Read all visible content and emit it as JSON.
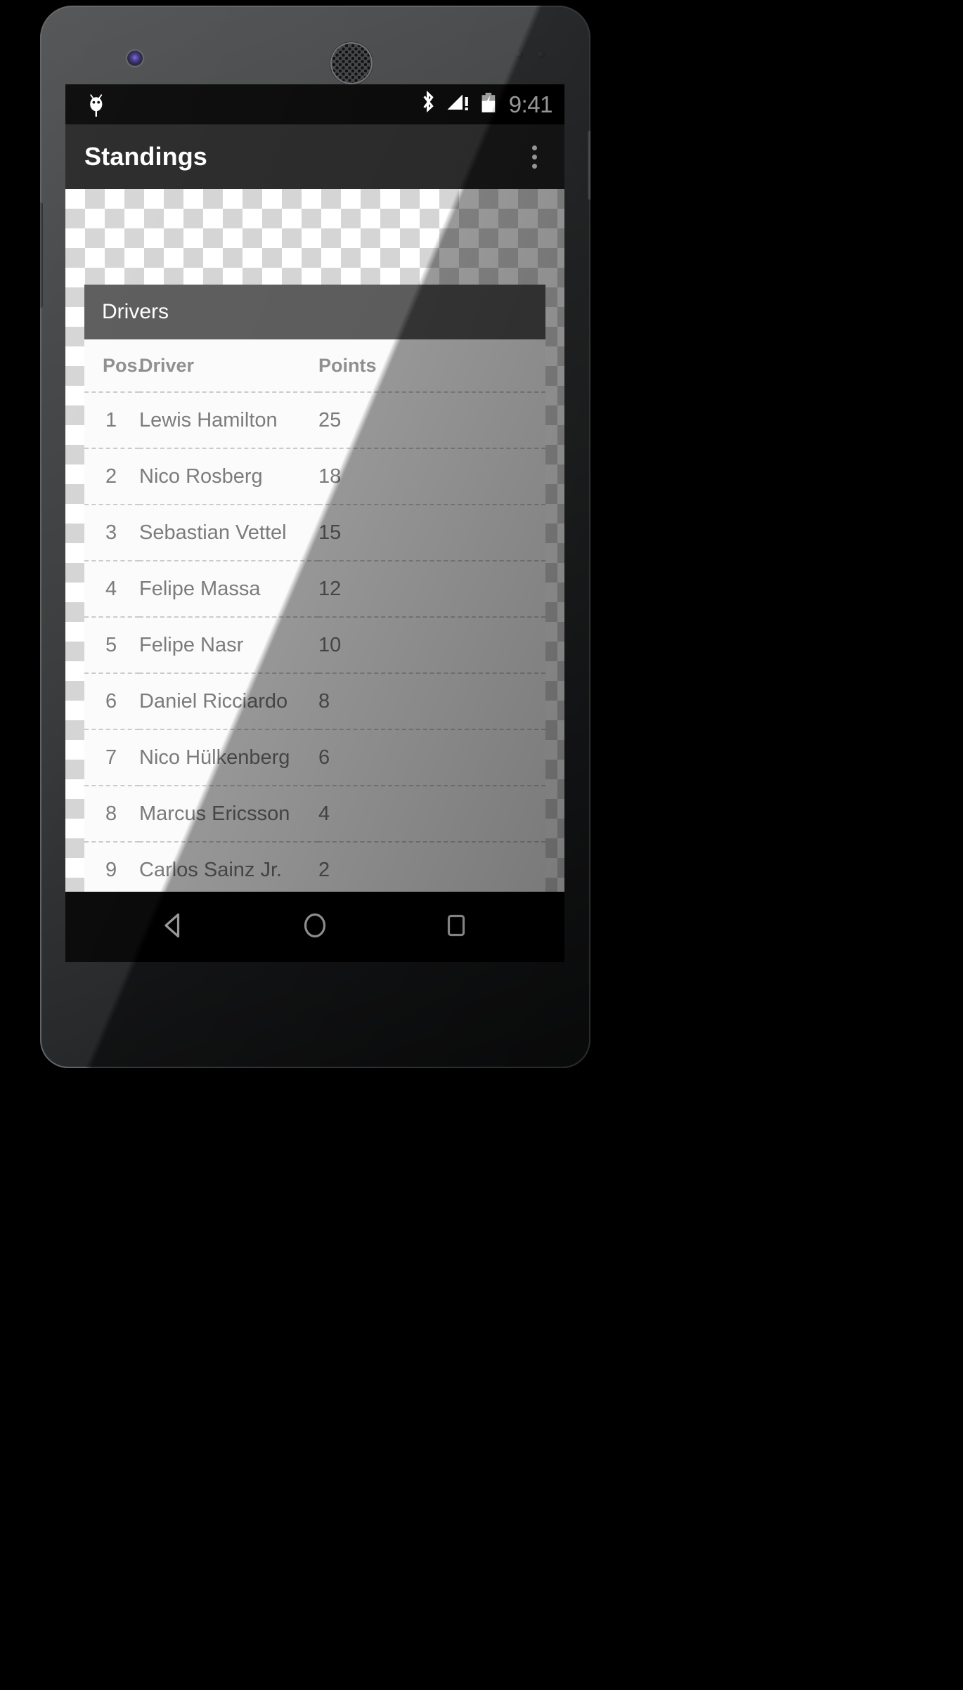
{
  "device": {
    "kind": "android-phone-mockup",
    "camera_icon": "front-camera-icon",
    "speaker_icon": "earpiece-speaker-icon"
  },
  "status_bar": {
    "left_icon": "android-bugdroid-icon",
    "icons": [
      "bluetooth-icon",
      "cellular-signal-no-service-icon",
      "battery-charging-icon"
    ],
    "clock": "9:41",
    "background_color": "#000000",
    "foreground_color": "#ffffff"
  },
  "app_bar": {
    "title": "Standings",
    "overflow_icon": "overflow-menu-icon",
    "background_color": "#212121",
    "title_color": "#ffffff"
  },
  "content": {
    "background": "transparency-checkerboard",
    "checker_light": "#ffffff",
    "checker_dark": "#d3d3d3"
  },
  "card": {
    "header_title": "Drivers",
    "header_background": "#555555",
    "header_text_color": "#ffffff",
    "body_background": "#fbfbfb",
    "divider_color": "#c8c8c8",
    "columns": [
      "Pos.",
      "Driver",
      "Points"
    ],
    "rows": [
      {
        "pos": "1",
        "driver": "Lewis Hamilton",
        "points": "25"
      },
      {
        "pos": "2",
        "driver": "Nico Rosberg",
        "points": "18"
      },
      {
        "pos": "3",
        "driver": "Sebastian Vettel",
        "points": "15"
      },
      {
        "pos": "4",
        "driver": "Felipe Massa",
        "points": "12"
      },
      {
        "pos": "5",
        "driver": "Felipe Nasr",
        "points": "10"
      },
      {
        "pos": "6",
        "driver": "Daniel Ricciardo",
        "points": "8"
      },
      {
        "pos": "7",
        "driver": "Nico Hülkenberg",
        "points": "6"
      },
      {
        "pos": "8",
        "driver": "Marcus Ericsson",
        "points": "4"
      },
      {
        "pos": "9",
        "driver": "Carlos Sainz Jr.",
        "points": "2"
      }
    ]
  },
  "nav_bar": {
    "background_color": "#000000",
    "buttons": [
      {
        "name": "back-button",
        "icon": "back-triangle-icon"
      },
      {
        "name": "home-button",
        "icon": "home-circle-icon"
      },
      {
        "name": "recents-button",
        "icon": "recents-square-icon"
      }
    ]
  }
}
